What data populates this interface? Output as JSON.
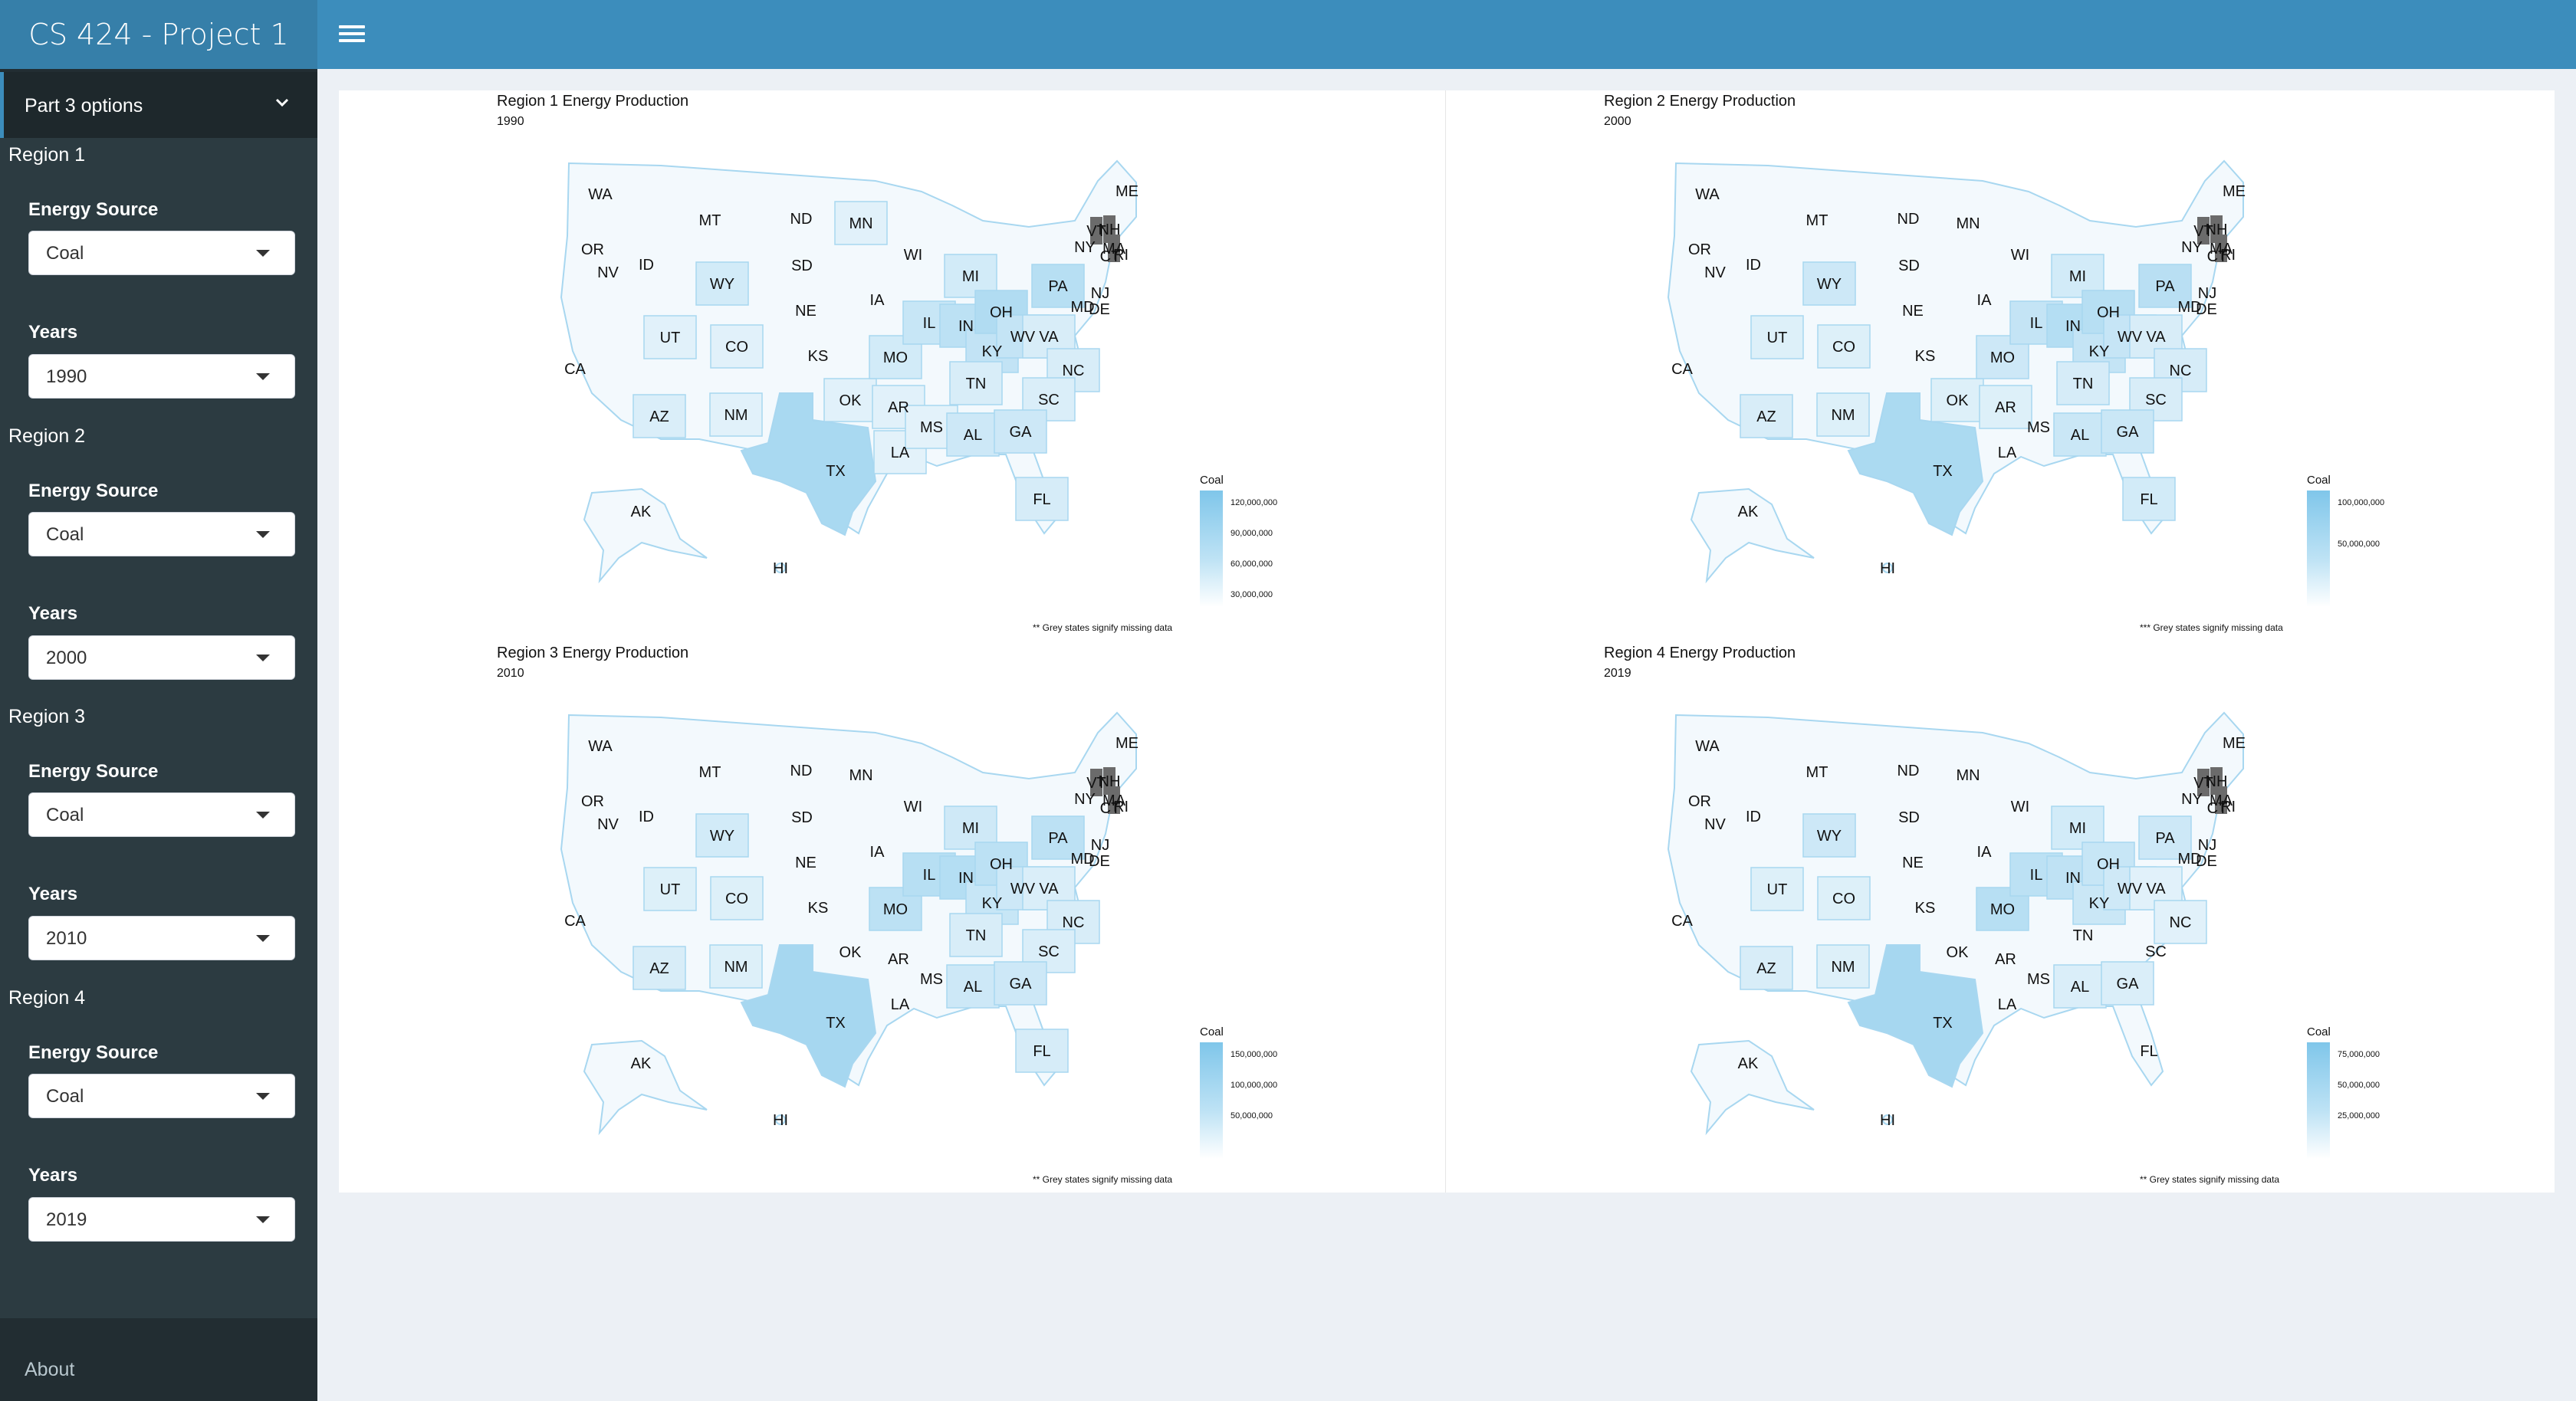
{
  "app": {
    "title": "CS 424 - Project 1"
  },
  "header": {
    "menu_toggle_icon": "hamburger-menu-icon"
  },
  "sidebar": {
    "menu_label": "Part 3 options",
    "menu_icon": "chevron-down-icon",
    "regions": [
      {
        "heading": "Region 1",
        "energy_label": "Energy Source",
        "energy_value": "Coal",
        "years_label": "Years",
        "years_value": "1990"
      },
      {
        "heading": "Region 2",
        "energy_label": "Energy Source",
        "energy_value": "Coal",
        "years_label": "Years",
        "years_value": "2000"
      },
      {
        "heading": "Region 3",
        "energy_label": "Energy Source",
        "energy_value": "Coal",
        "years_label": "Years",
        "years_value": "2010"
      },
      {
        "heading": "Region 4",
        "energy_label": "Energy Source",
        "energy_value": "Coal",
        "years_label": "Years",
        "years_value": "2019"
      }
    ],
    "about": "About"
  },
  "state_labels": [
    "WA",
    "OR",
    "CA",
    "NV",
    "ID",
    "MT",
    "WY",
    "UT",
    "AZ",
    "NM",
    "CO",
    "ND",
    "SD",
    "NE",
    "KS",
    "OK",
    "TX",
    "MN",
    "IA",
    "MO",
    "AR",
    "LA",
    "WI",
    "IL",
    "MS",
    "MI",
    "IN",
    "KY",
    "TN",
    "AL",
    "OH",
    "WV",
    "VA",
    "NC",
    "SC",
    "GA",
    "FL",
    "PA",
    "NY",
    "VT",
    "NH",
    "ME",
    "MA",
    "CT",
    "RI",
    "NJ",
    "DE",
    "MD",
    "AK",
    "HI"
  ],
  "plots": [
    {
      "title": "Region 1 Energy Production",
      "subtitle": "1990",
      "legend_title": "Coal",
      "legend_ticks": [
        "120,000,000",
        "90,000,000",
        "60,000,000",
        "30,000,000"
      ],
      "note": "** Grey states signify missing data"
    },
    {
      "title": "Region 2 Energy Production",
      "subtitle": "2000",
      "legend_title": "Coal",
      "legend_ticks": [
        "100,000,000",
        "50,000,000"
      ],
      "note": "*** Grey states signify missing data"
    },
    {
      "title": "Region 3 Energy Production",
      "subtitle": "2010",
      "legend_title": "Coal",
      "legend_ticks": [
        "150,000,000",
        "100,000,000",
        "50,000,000"
      ],
      "note": "** Grey states signify missing data"
    },
    {
      "title": "Region 4 Energy Production",
      "subtitle": "2019",
      "legend_title": "Coal",
      "legend_ticks": [
        "75,000,000",
        "50,000,000",
        "25,000,000"
      ],
      "note": "** Grey states signify missing data"
    }
  ],
  "colors": {
    "missing": "#6b6b6b",
    "high": "#7fc6ea",
    "low": "#eef7fc"
  }
}
